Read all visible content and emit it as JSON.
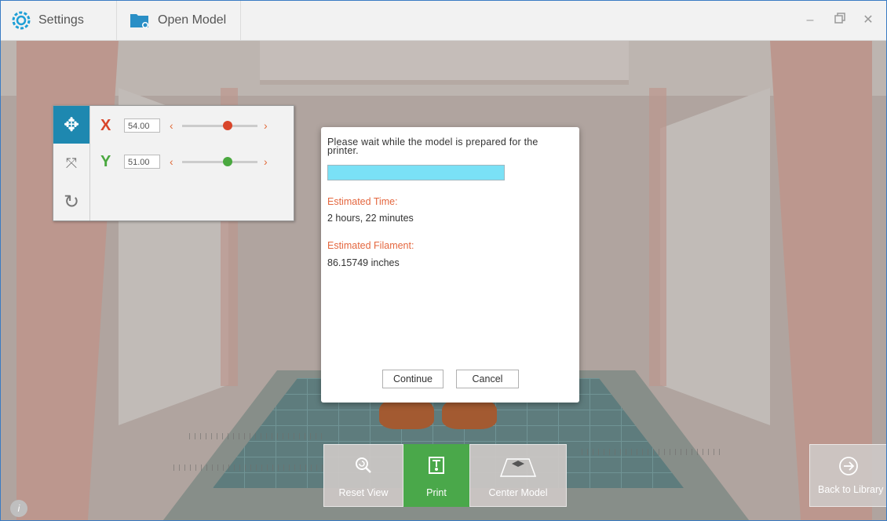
{
  "titlebar": {
    "settings_label": "Settings",
    "open_model_label": "Open Model",
    "minimize_icon": "minimize-icon",
    "restore_icon": "restore-icon",
    "close_icon": "close-icon"
  },
  "transform_panel": {
    "tools": [
      "move-icon",
      "scale-icon",
      "rotate-icon"
    ],
    "x_label": "X",
    "x_value": "54.00",
    "y_label": "Y",
    "y_value": "51.00",
    "x_color": "#d9452a",
    "y_color": "#4aa83f",
    "x_slider_fraction": 0.78,
    "y_slider_fraction": 0.78
  },
  "dialog": {
    "message": "Please wait while the model is prepared for the printer.",
    "progress_fraction": 1.0,
    "progress_color": "#7ae1f6",
    "time_label": "Estimated Time:",
    "time_value": "2 hours, 22 minutes",
    "filament_label": "Estimated Filament:",
    "filament_value": "86.15749 inches",
    "continue_label": "Continue",
    "cancel_label": "Cancel",
    "label_color": "#e4673f"
  },
  "toolbar": {
    "reset_view_label": "Reset View",
    "print_label": "Print",
    "center_model_label": "Center Model",
    "back_label": "Back to Library",
    "print_color": "#4aa84a"
  },
  "info_icon": "i"
}
